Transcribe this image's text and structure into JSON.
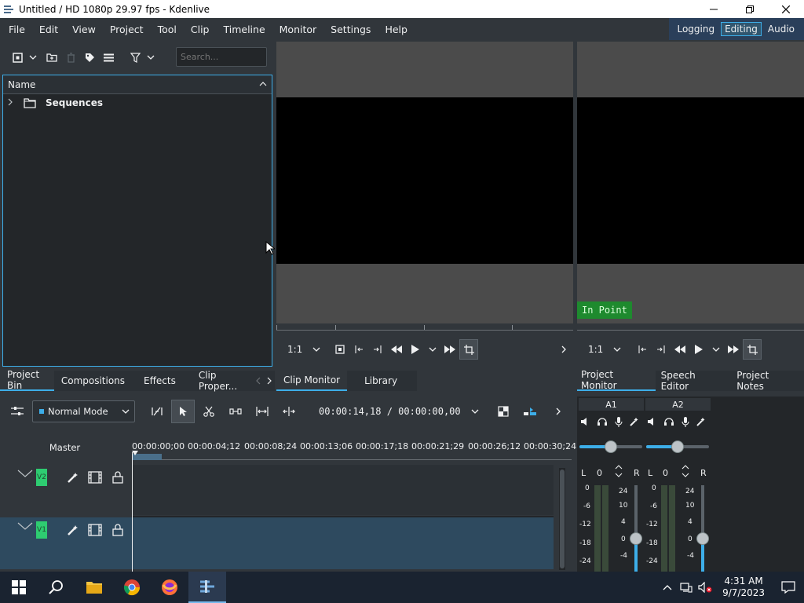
{
  "window": {
    "title": "Untitled / HD 1080p 29.97 fps - Kdenlive"
  },
  "menu": [
    "File",
    "Edit",
    "View",
    "Project",
    "Tool",
    "Clip",
    "Timeline",
    "Monitor",
    "Settings",
    "Help"
  ],
  "workspaces": {
    "logging": "Logging",
    "editing": "Editing",
    "audio": "Audio"
  },
  "bin": {
    "search_placeholder": "Search...",
    "column_name": "Name",
    "items": [
      {
        "label": "Sequences"
      }
    ]
  },
  "clip_monitor": {
    "zoom": "1:1"
  },
  "project_monitor": {
    "zoom": "1:1",
    "marker": "In Point"
  },
  "left_tabs": {
    "project_bin": "Project Bin",
    "compositions": "Compositions",
    "effects": "Effects",
    "clip_properties": "Clip Proper..."
  },
  "center_tabs": {
    "clip_monitor": "Clip Monitor",
    "library": "Library"
  },
  "right_tabs": {
    "project_monitor": "Project Monitor",
    "speech_editor": "Speech Editor",
    "project_notes": "Project Notes"
  },
  "timeline": {
    "mode": "Normal Mode",
    "timecode": "00:00:14,18 / 00:00:00,00",
    "master_label": "Master",
    "ruler": [
      "00:00:00;00",
      "00:00:04;12",
      "00:00:08;24",
      "00:00:13;06",
      "00:00:17;18",
      "00:00:21;29",
      "00:00:26;12",
      "00:00:30;24"
    ],
    "tracks": [
      {
        "name": "V2"
      },
      {
        "name": "V1"
      }
    ]
  },
  "mixer": {
    "channels": [
      {
        "name": "A1",
        "left": "L",
        "value": "0",
        "right": "R"
      },
      {
        "name": "A2",
        "left": "L",
        "value": "0",
        "right": "R"
      }
    ],
    "scale_left": [
      "0",
      "-6",
      "-12",
      "-18",
      "-24"
    ],
    "scale_right": [
      "24",
      "10",
      "4",
      "0",
      "-4"
    ]
  },
  "taskbar": {
    "time": "4:31 AM",
    "date": "9/7/2023"
  },
  "colors": {
    "accent": "#3daee9",
    "panel": "#31363b",
    "in_point": "#1e8a2e",
    "track_green": "#2ecc71"
  }
}
